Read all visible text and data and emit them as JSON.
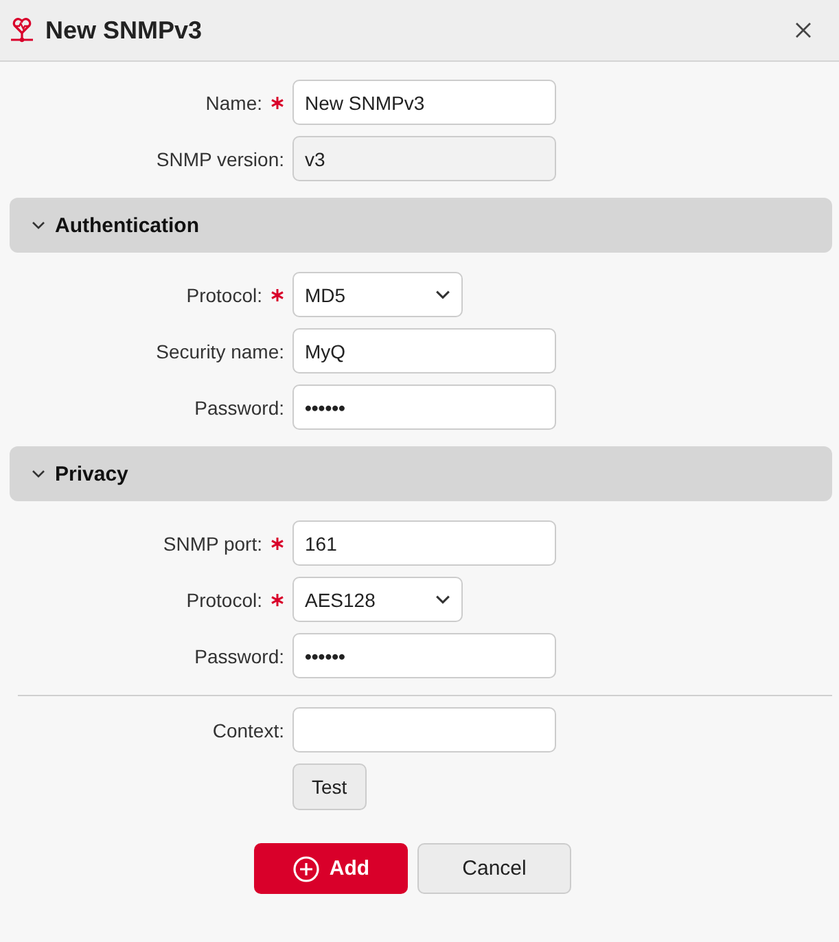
{
  "dialog": {
    "title": "New SNMPv3"
  },
  "fields": [
    {
      "label": "Name:",
      "required": true,
      "kind": "text",
      "value": "New SNMPv3"
    },
    {
      "label": "SNMP version:",
      "required": false,
      "kind": "readonly",
      "value": "v3"
    }
  ],
  "sections": [
    {
      "title": "Authentication",
      "expanded": true,
      "fields": [
        {
          "label": "Protocol:",
          "required": true,
          "kind": "select",
          "value": "MD5"
        },
        {
          "label": "Security name:",
          "required": false,
          "kind": "text",
          "value": "MyQ"
        },
        {
          "label": "Password:",
          "required": false,
          "kind": "password",
          "value": "••••••"
        }
      ]
    },
    {
      "title": "Privacy",
      "expanded": true,
      "fields": [
        {
          "label": "SNMP port:",
          "required": true,
          "kind": "text",
          "value": "161"
        },
        {
          "label": "Protocol:",
          "required": true,
          "kind": "select",
          "value": "AES128"
        },
        {
          "label": "Password:",
          "required": false,
          "kind": "password",
          "value": "••••••"
        }
      ]
    }
  ],
  "context": {
    "label": "Context:",
    "required": false
  },
  "test_button": "Test",
  "buttons": [
    {
      "label": "Add",
      "kind": "primary"
    },
    {
      "label": "Cancel",
      "kind": "secondary"
    }
  ]
}
